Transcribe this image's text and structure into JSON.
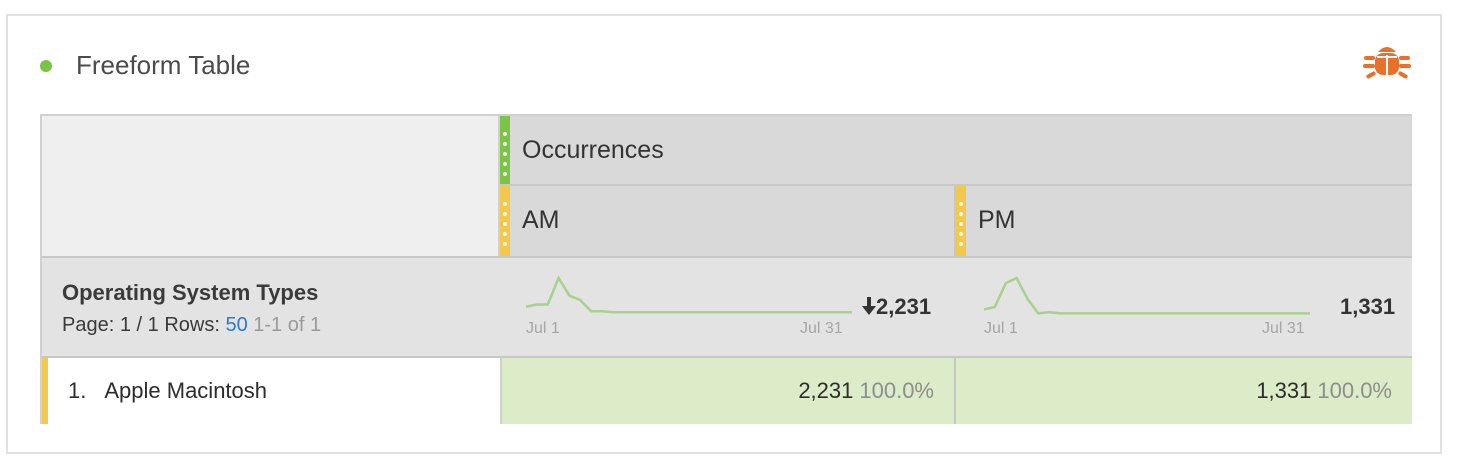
{
  "panel": {
    "title": "Freeform Table",
    "status_color": "#7cc446",
    "bug_icon": "bug-icon",
    "accent_color": "#e8702a"
  },
  "table": {
    "metric_header": "Occurrences",
    "segments": [
      {
        "label": "AM",
        "color": "#f4c84a"
      },
      {
        "label": "PM",
        "color": "#f4c84a"
      }
    ],
    "metric_color": "#7cc446",
    "dimension": {
      "title": "Operating System Types",
      "page_label": "Page: 1 / 1",
      "rows_label": "Rows:",
      "rows_value": "50",
      "range_label": "1-1 of 1"
    },
    "summary": [
      {
        "total": "2,231",
        "trend_icon": "arrow-down-icon",
        "sparkline": {
          "start_label": "Jul 1",
          "end_label": "Jul 31",
          "values": [
            12,
            14,
            14,
            38,
            22,
            18,
            8,
            8,
            7,
            7,
            7,
            7,
            7,
            7,
            7,
            7,
            7,
            7,
            7,
            7,
            7,
            7,
            7,
            7,
            7,
            7,
            7,
            7,
            7,
            7,
            7
          ]
        }
      },
      {
        "total": "1,331",
        "trend_icon": "",
        "sparkline": {
          "start_label": "Jul 1",
          "end_label": "Jul 31",
          "values": [
            8,
            10,
            28,
            32,
            16,
            5,
            6,
            5,
            5,
            5,
            5,
            5,
            5,
            5,
            5,
            5,
            5,
            5,
            5,
            5,
            5,
            5,
            5,
            5,
            5,
            5,
            5,
            5,
            5,
            5,
            5
          ]
        }
      }
    ],
    "rows": [
      {
        "index": "1.",
        "label": "Apple Macintosh",
        "am_value": "2,231",
        "am_pct": "100.0%",
        "pm_value": "1,331",
        "pm_pct": "100.0%"
      }
    ],
    "cell_highlight": "#dcebc8"
  }
}
